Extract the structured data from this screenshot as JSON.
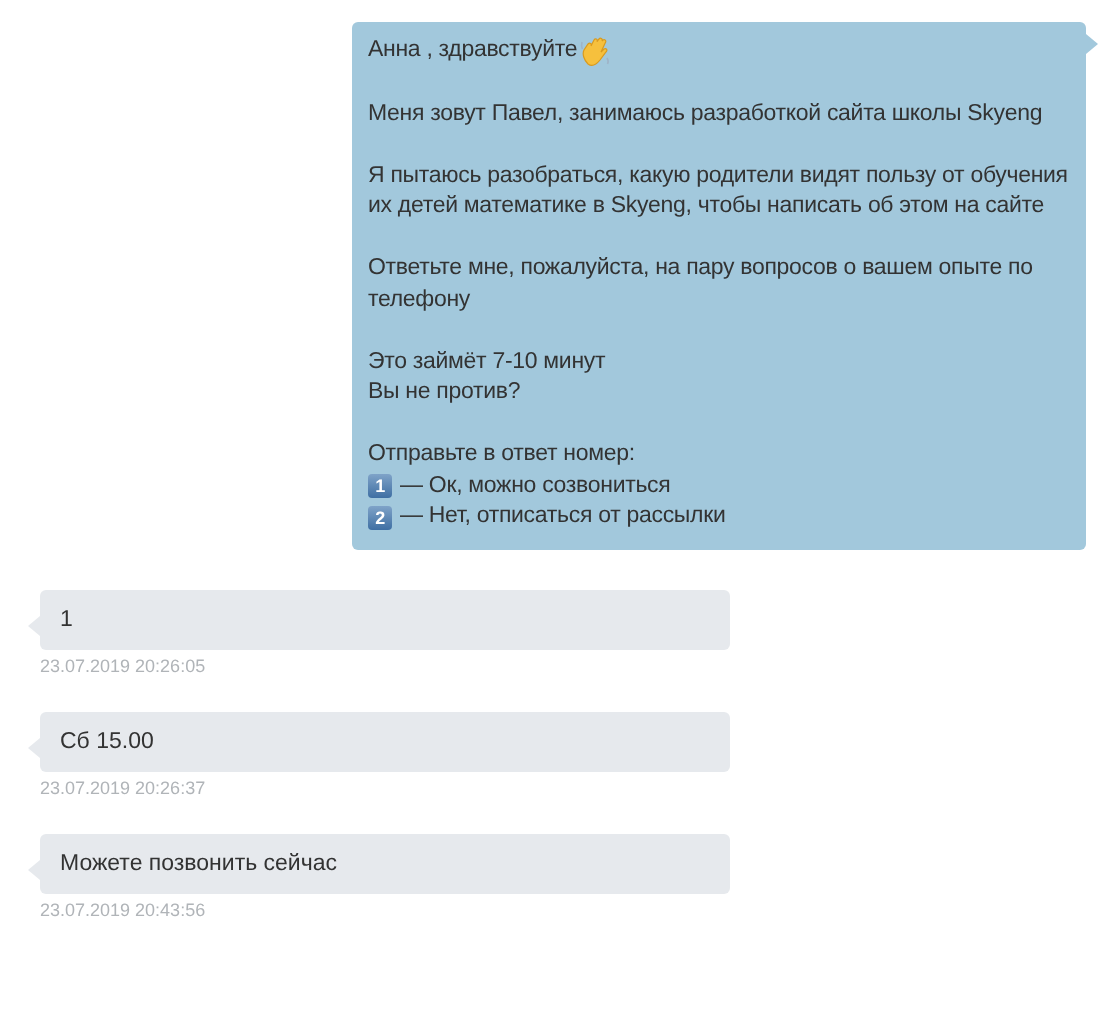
{
  "messages": [
    {
      "kind": "outgoing",
      "greeting": "Анна , здравствуйте",
      "paragraphs": [
        [
          "Меня зовут Павел, занимаюсь разработкой сайта школы Skyeng"
        ],
        [
          "Я пытаюсь разобраться, какую родители видят пользу от обучения их детей математике в Skyeng, чтобы написать об этом на сайте"
        ],
        [
          "Ответьте мне, пожалуйста, на пару вопросов о вашем опыте по телефону"
        ],
        [
          "Это займёт 7-10 минут",
          "Вы не против?"
        ],
        [
          "Отправьте в ответ номер:"
        ]
      ],
      "options": [
        {
          "key": "1",
          "text": "— Ок, можно созвониться"
        },
        {
          "key": "2",
          "text": "— Нет, отписаться от рассылки"
        }
      ]
    },
    {
      "kind": "incoming",
      "text": "1",
      "time": "23.07.2019 20:26:05"
    },
    {
      "kind": "incoming",
      "text": "Сб 15.00",
      "time": "23.07.2019 20:26:37"
    },
    {
      "kind": "incoming",
      "text": "Можете позвонить сейчас",
      "time": "23.07.2019 20:43:56"
    }
  ]
}
